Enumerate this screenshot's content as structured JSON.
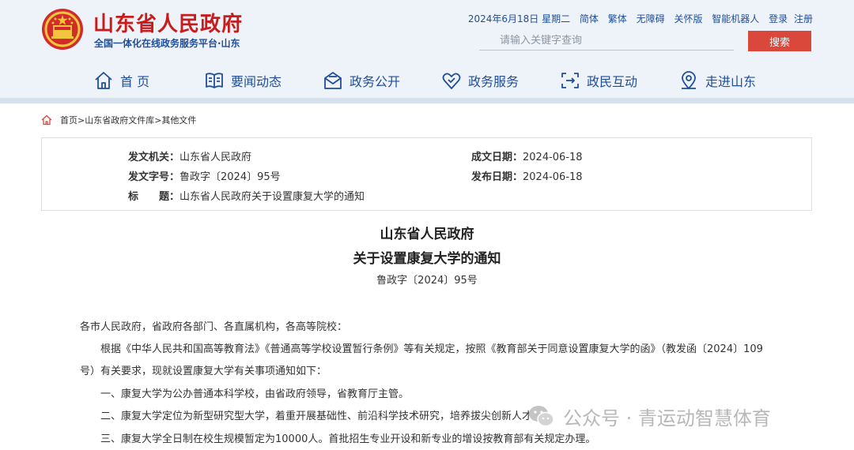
{
  "header": {
    "site_title": "山东省人民政府",
    "site_subtitle": "全国一体化在线政务服务平台·山东",
    "date": "2024年6月18日 星期二",
    "links": [
      "简体",
      "繁体",
      "无障碍",
      "关怀版",
      "智能机器人",
      "登录",
      "注册"
    ],
    "search_placeholder": "请输入关键字查询",
    "search_button": "搜索"
  },
  "nav": [
    {
      "label": "首 页",
      "icon": "home-icon"
    },
    {
      "label": "要闻动态",
      "icon": "book-icon"
    },
    {
      "label": "政务公开",
      "icon": "mail-icon"
    },
    {
      "label": "政务服务",
      "icon": "heart-icon"
    },
    {
      "label": "政民互动",
      "icon": "interaction-icon"
    },
    {
      "label": "走进山东",
      "icon": "location-icon"
    }
  ],
  "breadcrumb": "首页>山东省政府文件库>其他文件",
  "info": {
    "issuer_label": "发文机关：",
    "issuer": "山东省人民政府",
    "doc_no_label": "发文字号：",
    "doc_no": "鲁政字〔2024〕95号",
    "title_label": "标　　题：",
    "title": "山东省人民政府关于设置康复大学的通知",
    "written_label": "成文日期：",
    "written": "2024-06-18",
    "published_label": "发布日期：",
    "published": "2024-06-18"
  },
  "document": {
    "title_line1": "山东省人民政府",
    "title_line2": "关于设置康复大学的通知",
    "number": "鲁政字〔2024〕95号",
    "salutation": "各市人民政府，省政府各部门、各直属机构，各高等院校：",
    "para1_line1": "根据《中华人民共和国高等教育法》《普通高等学校设置暂行条例》等有关规定，按照《教育部关于同意设置康复大学的函》（教发函〔2024〕109",
    "para1_line2": "号）有关要求，现就设置康复大学有关事项通知如下：",
    "item1": "一、康复大学为公办普通本科学校，由省政府领导，省教育厅主管。",
    "item2": "二、康复大学定位为新型研究型大学，着重开展基础性、前沿科学技术研究，培养拔尖创新人才。",
    "item3": "三、康复大学全日制在校生规模暂定为10000人。首批招生专业开设和新专业的增设按教育部有关规定办理。"
  },
  "watermark": "公众号 · 青运动智慧体育",
  "colors": {
    "brand_red": "#c81c1c",
    "nav_blue": "#1f4e9b",
    "search_button": "#d9483b",
    "header_bg": "#eef3f9"
  }
}
